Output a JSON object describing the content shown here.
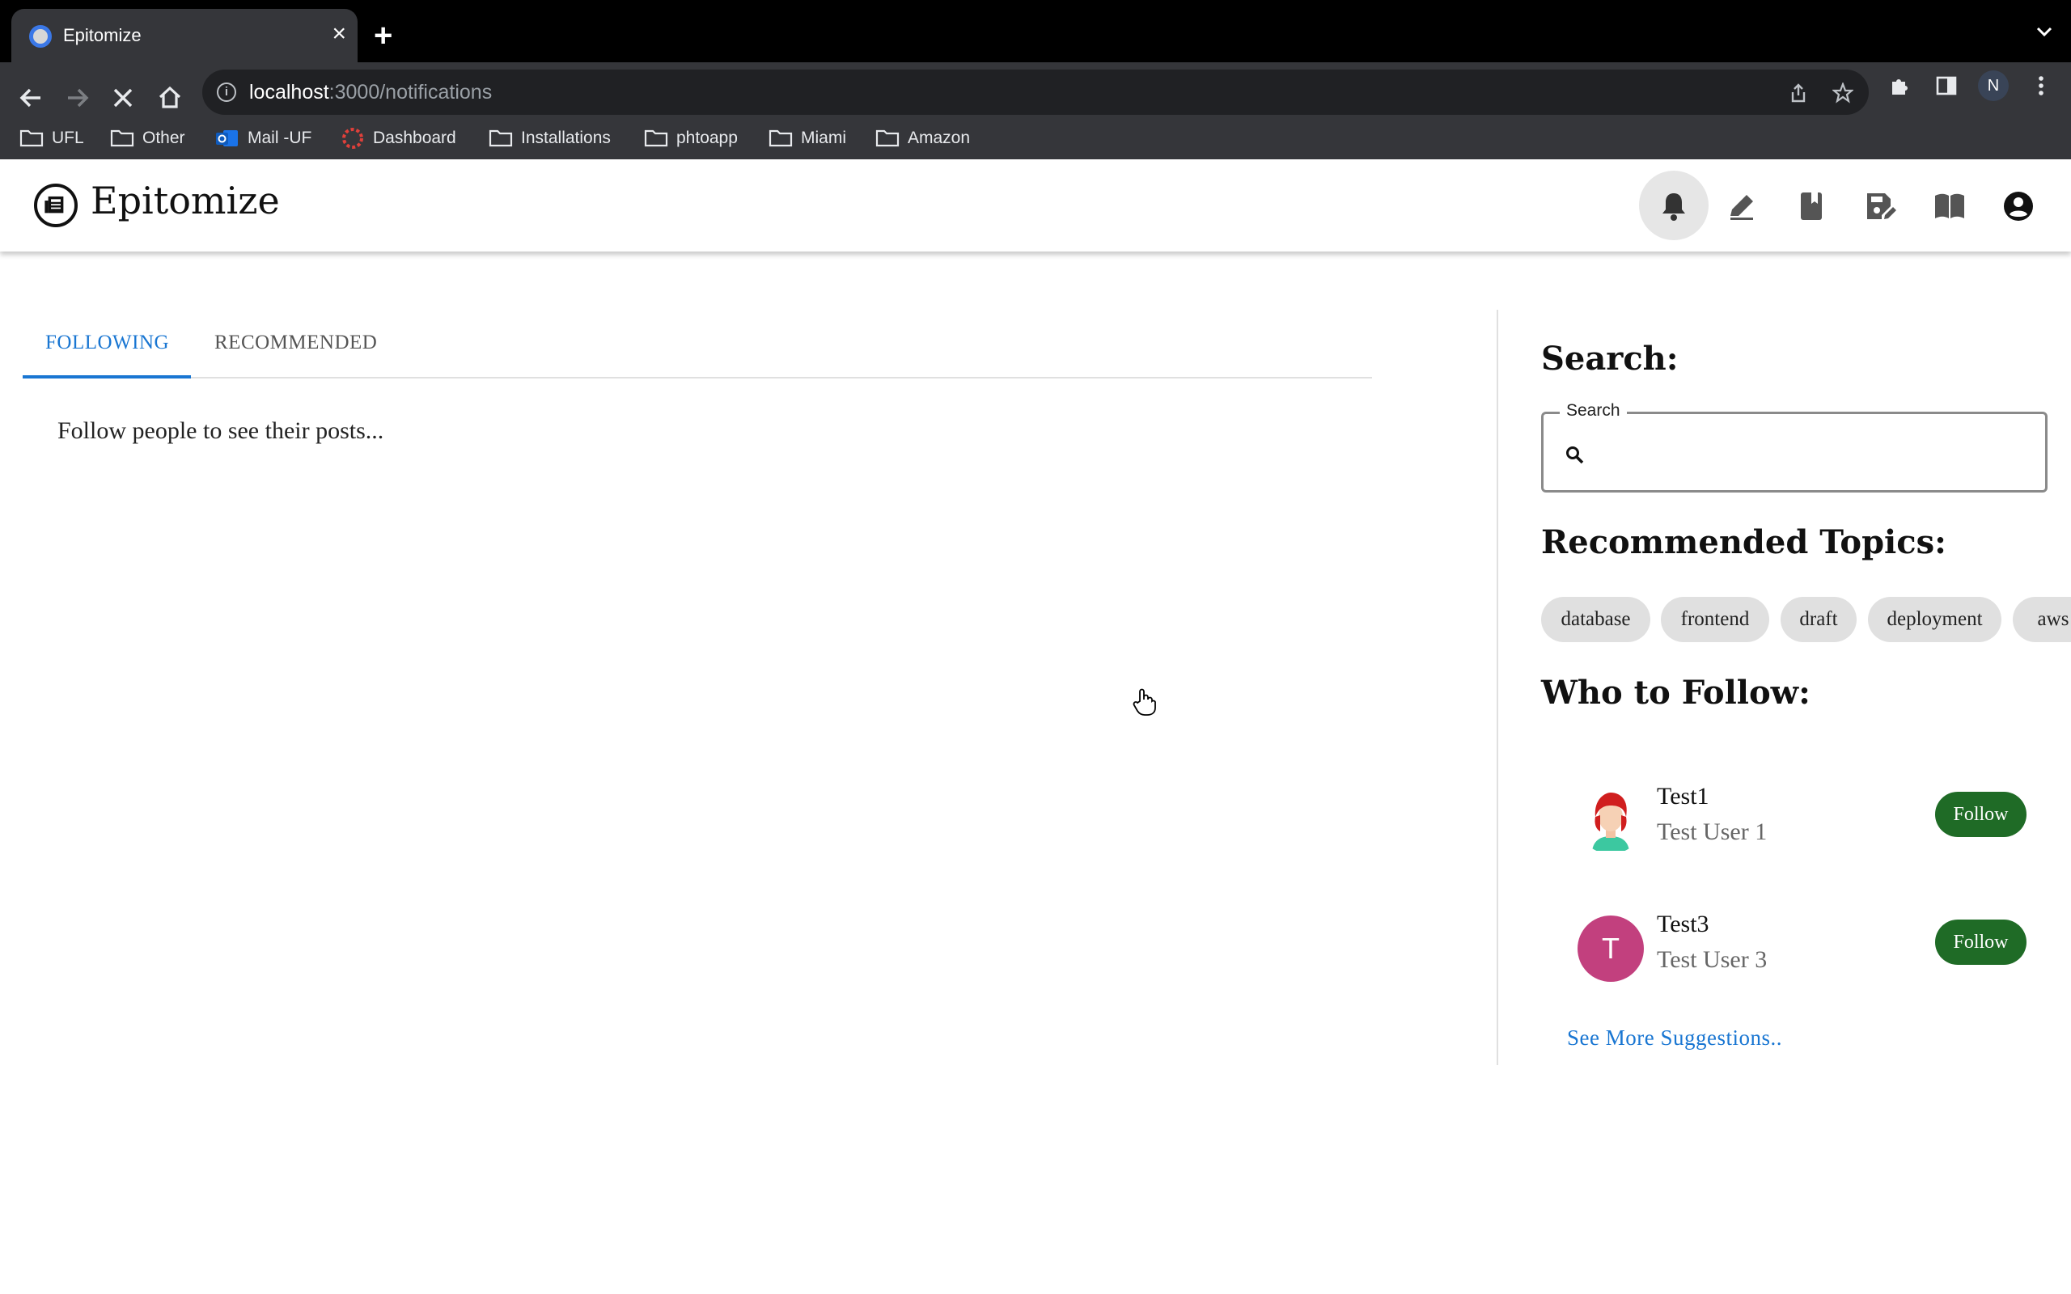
{
  "browser": {
    "tab_title": "Epitomize",
    "url_host": "localhost",
    "url_path": ":3000/notifications",
    "profile_initial": "N",
    "bookmarks": [
      {
        "label": "UFL",
        "icon": "folder-icon"
      },
      {
        "label": "Other",
        "icon": "folder-icon"
      },
      {
        "label": "Mail -UF",
        "icon": "outlook-icon"
      },
      {
        "label": "Dashboard",
        "icon": "dashboard-icon"
      },
      {
        "label": "Installations",
        "icon": "folder-icon"
      },
      {
        "label": "phtoapp",
        "icon": "folder-icon"
      },
      {
        "label": "Miami",
        "icon": "folder-icon"
      },
      {
        "label": "Amazon",
        "icon": "folder-icon"
      }
    ]
  },
  "header": {
    "app_name": "Epitomize",
    "nav_icons": [
      "bell-icon",
      "pencil-icon",
      "book-icon",
      "save-edit-icon",
      "book-open-icon",
      "account-icon"
    ]
  },
  "main": {
    "tabs": [
      {
        "label": "FOLLOWING",
        "active": true
      },
      {
        "label": "RECOMMENDED",
        "active": false
      }
    ],
    "empty_message": "Follow people to see their posts..."
  },
  "sidebar": {
    "search_heading": "Search:",
    "search_label": "Search",
    "search_value": "",
    "topics_heading": "Recommended Topics:",
    "topics": [
      "database",
      "frontend",
      "draft",
      "deployment",
      "aws"
    ],
    "follow_heading": "Who to Follow:",
    "suggestions": [
      {
        "name": "Test1",
        "username": "Test User 1",
        "avatar": "illustrated-avatar",
        "button": "Follow"
      },
      {
        "name": "Test3",
        "username": "Test User 3",
        "avatar_letter": "T",
        "button": "Follow"
      }
    ],
    "see_more": "See More Suggestions.."
  },
  "colors": {
    "accent": "#1976d2",
    "follow_button": "#1f6b26",
    "avatar_t": "#c2407e"
  }
}
